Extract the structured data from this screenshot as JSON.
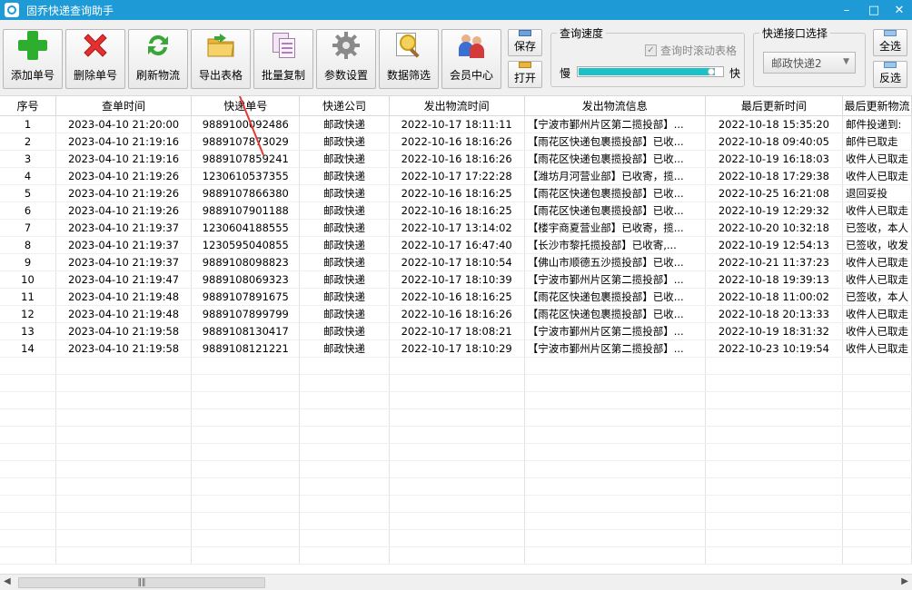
{
  "window": {
    "title": "固乔快递查询助手"
  },
  "toolbar": {
    "buttons": [
      {
        "label": "添加单号",
        "icon": "add-icon"
      },
      {
        "label": "删除单号",
        "icon": "delete-icon"
      },
      {
        "label": "刷新物流",
        "icon": "refresh-icon"
      },
      {
        "label": "导出表格",
        "icon": "export-folder-icon"
      },
      {
        "label": "批量复制",
        "icon": "copy-icon"
      },
      {
        "label": "参数设置",
        "icon": "gear-icon"
      },
      {
        "label": "数据筛选",
        "icon": "filter-search-icon"
      },
      {
        "label": "会员中心",
        "icon": "members-icon"
      }
    ],
    "save_label": "保存",
    "open_label": "打开",
    "speed": {
      "legend": "查询速度",
      "scroll_label": "查询时滚动表格",
      "scroll_checked": true,
      "slow": "慢",
      "fast": "快",
      "level": 0.95
    },
    "api": {
      "legend": "快递接口选择",
      "selected": "邮政快递2"
    },
    "select_all": "全选",
    "invert": "反选"
  },
  "table": {
    "columns": [
      "序号",
      "查单时间",
      "快递单号",
      "快递公司",
      "发出物流时间",
      "发出物流信息",
      "最后更新时间",
      "最后更新物流"
    ],
    "rows": [
      [
        "1",
        "2023-04-10  21:20:00",
        "9889100092486",
        "邮政快递",
        "2022-10-17  18:11:11",
        "【宁波市鄞州片区第二揽投部】...",
        "2022-10-18  15:35:20",
        "邮件投递到:"
      ],
      [
        "2",
        "2023-04-10  21:19:16",
        "9889107873029",
        "邮政快递",
        "2022-10-16  18:16:26",
        "【雨花区快递包裹揽投部】已收...",
        "2022-10-18  09:40:05",
        "邮件已取走"
      ],
      [
        "3",
        "2023-04-10  21:19:16",
        "9889107859241",
        "邮政快递",
        "2022-10-16  18:16:26",
        "【雨花区快递包裹揽投部】已收...",
        "2022-10-19  16:18:03",
        "收件人已取走"
      ],
      [
        "4",
        "2023-04-10  21:19:26",
        "1230610537355",
        "邮政快递",
        "2022-10-17  17:22:28",
        "【潍坊月河营业部】已收寄，揽...",
        "2022-10-18  17:29:38",
        "收件人已取走"
      ],
      [
        "5",
        "2023-04-10  21:19:26",
        "9889107866380",
        "邮政快递",
        "2022-10-16  18:16:25",
        "【雨花区快递包裹揽投部】已收...",
        "2022-10-25  16:21:08",
        "退回妥投"
      ],
      [
        "6",
        "2023-04-10  21:19:26",
        "9889107901188",
        "邮政快递",
        "2022-10-16  18:16:25",
        "【雨花区快递包裹揽投部】已收...",
        "2022-10-19  12:29:32",
        "收件人已取走"
      ],
      [
        "7",
        "2023-04-10  21:19:37",
        "1230604188555",
        "邮政快递",
        "2022-10-17  13:14:02",
        "【楼宇商夏营业部】已收寄，揽...",
        "2022-10-20  10:32:18",
        "已签收，本人"
      ],
      [
        "8",
        "2023-04-10  21:19:37",
        "1230595040855",
        "邮政快递",
        "2022-10-17  16:47:40",
        "【长沙市黎托揽投部】已收寄,...",
        "2022-10-19  12:54:13",
        "已签收，收发"
      ],
      [
        "9",
        "2023-04-10  21:19:37",
        "9889108098823",
        "邮政快递",
        "2022-10-17  18:10:54",
        "【佛山市顺德五沙揽投部】已收...",
        "2022-10-21  11:37:23",
        "收件人已取走"
      ],
      [
        "10",
        "2023-04-10  21:19:47",
        "9889108069323",
        "邮政快递",
        "2022-10-17  18:10:39",
        "【宁波市鄞州片区第二揽投部】...",
        "2022-10-18  19:39:13",
        "收件人已取走"
      ],
      [
        "11",
        "2023-04-10  21:19:48",
        "9889107891675",
        "邮政快递",
        "2022-10-16  18:16:25",
        "【雨花区快递包裹揽投部】已收...",
        "2022-10-18  11:00:02",
        "已签收，本人"
      ],
      [
        "12",
        "2023-04-10  21:19:48",
        "9889107899799",
        "邮政快递",
        "2022-10-16  18:16:26",
        "【雨花区快递包裹揽投部】已收...",
        "2022-10-18  20:13:33",
        "收件人已取走"
      ],
      [
        "13",
        "2023-04-10  21:19:58",
        "9889108130417",
        "邮政快递",
        "2022-10-17  18:08:21",
        "【宁波市鄞州片区第二揽投部】...",
        "2022-10-19  18:31:32",
        "收件人已取走"
      ],
      [
        "14",
        "2023-04-10  21:19:58",
        "9889108121221",
        "邮政快递",
        "2022-10-17  18:10:29",
        "【宁波市鄞州片区第二揽投部】...",
        "2022-10-23  10:19:54",
        "收件人已取走"
      ]
    ]
  },
  "colors": {
    "titlebar": "#1e9bd7",
    "accent_arrow": "#e53935",
    "slider": "#19c2c9"
  }
}
